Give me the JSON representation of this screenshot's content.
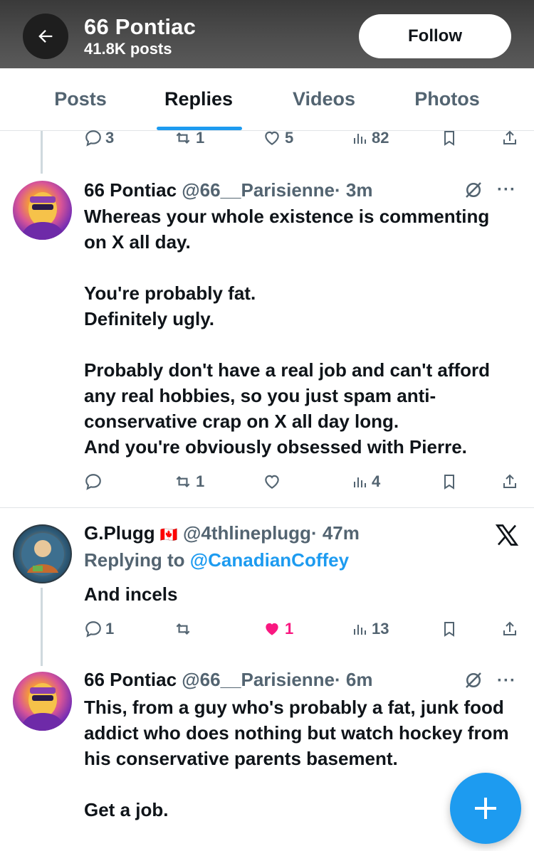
{
  "header": {
    "title": "66 Pontiac",
    "posts_count": "41.8K posts",
    "follow_label": "Follow"
  },
  "tabs": [
    {
      "label": "Posts",
      "active": false
    },
    {
      "label": "Replies",
      "active": true
    },
    {
      "label": "Videos",
      "active": false
    },
    {
      "label": "Photos",
      "active": false
    }
  ],
  "top_actions": {
    "replies": "3",
    "reposts": "1",
    "likes": "5",
    "views": "82"
  },
  "tweets": [
    {
      "name": "66 Pontiac",
      "handle": "@66__Parisienne",
      "time": "· 3m",
      "text": "Whereas your whole existence is commenting on X all day.\n\nYou're probably fat.\nDefinitely ugly.\n\nProbably don't have a real job and can't afford any real hobbies, so you just spam anti-conservative crap on X all day long.\nAnd you're obviously obsessed with Pierre.",
      "actions": {
        "replies": "",
        "reposts": "1",
        "likes": "",
        "views": "4"
      }
    },
    {
      "name": "G.Plugg",
      "flag": "🇨🇦",
      "handle": "@4thlineplugg",
      "time": "· 47m",
      "replying_prefix": "Replying to",
      "replying_to": "@CanadianCoffey",
      "text": "And incels",
      "actions": {
        "replies": "1",
        "reposts": "",
        "likes": "1",
        "views": "13"
      }
    },
    {
      "name": "66 Pontiac",
      "handle": "@66__Parisienne",
      "time": "· 6m",
      "text": "This, from a guy who's probably a fat, junk food addict who does nothing but watch hockey from his conservative parents basement.\n\nGet a job."
    }
  ],
  "colors": {
    "accent": "#1d9bf0",
    "like": "#f91880",
    "muted": "#536471"
  }
}
